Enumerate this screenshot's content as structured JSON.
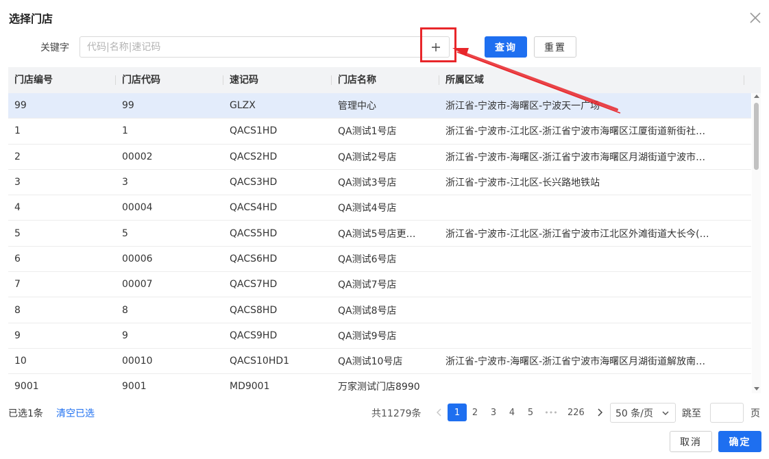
{
  "dialog": {
    "title": "选择门店"
  },
  "search": {
    "label": "关键字",
    "placeholder": "代码|名称|速记码",
    "value": ""
  },
  "buttons": {
    "query": "查询",
    "reset": "重置",
    "cancel": "取消",
    "ok": "确定"
  },
  "table": {
    "columns": [
      "门店编号",
      "门店代码",
      "速记码",
      "门店名称",
      "所属区域"
    ],
    "rows": [
      [
        "99",
        "99",
        "GLZX",
        "管理中心",
        "浙江省-宁波市-海曙区-宁波天一广场"
      ],
      [
        "1",
        "1",
        "QACS1HD",
        "QA测试1号店",
        "浙江省-宁波市-江北区-浙江省宁波市海曙区江厦街道新街社…"
      ],
      [
        "2",
        "00002",
        "QACS2HD",
        "QA测试2号店",
        "浙江省-宁波市-海曙区-浙江省宁波市海曙区月湖街道宁波市…"
      ],
      [
        "3",
        "3",
        "QACS3HD",
        "QA测试3号店",
        "浙江省-宁波市-江北区-长兴路地铁站"
      ],
      [
        "4",
        "00004",
        "QACS4HD",
        "QA测试4号店",
        ""
      ],
      [
        "5",
        "5",
        "QACS5HD",
        "QA测试5号店更…",
        "浙江省-宁波市-江北区-浙江省宁波市江北区外滩街道大长今(…"
      ],
      [
        "6",
        "00006",
        "QACS6HD",
        "QA测试6号店",
        ""
      ],
      [
        "7",
        "00007",
        "QACS7HD",
        "QA测试7号店",
        ""
      ],
      [
        "8",
        "8",
        "QACS8HD",
        "QA测试8号店",
        ""
      ],
      [
        "9",
        "9",
        "QACS9HD",
        "QA测试9号店",
        ""
      ],
      [
        "10",
        "00010",
        "QACS10HD1",
        "QA测试10号店",
        "浙江省-宁波市-海曙区-浙江省宁波市海曙区月湖街道解放南…"
      ],
      [
        "9001",
        "9001",
        "MD9001",
        "万家测试门店8990",
        ""
      ]
    ],
    "selected_row": 0
  },
  "footer": {
    "selected_count": "已选1条",
    "clear_selected": "清空已选",
    "total": "共11279条",
    "pages": [
      "1",
      "2",
      "3",
      "4",
      "5",
      "•••",
      "226"
    ],
    "current_page": "1",
    "page_size": "50 条/页",
    "jump_label": "跳至",
    "page_unit": "页"
  },
  "icons": {
    "close": "close-icon",
    "plus": "plus-icon",
    "prev": "chevron-left-icon",
    "next": "chevron-right-icon",
    "dropdown": "chevron-down-icon"
  },
  "colors": {
    "primary": "#1e6ff0",
    "annotation": "#e8262a",
    "selected_row": "#e3ecfb"
  }
}
